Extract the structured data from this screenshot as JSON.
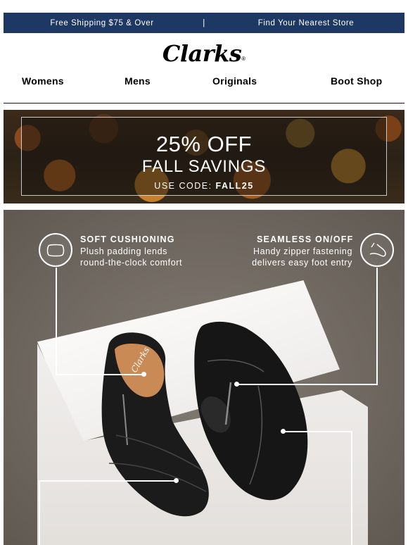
{
  "topbar": {
    "left_link": "Free Shipping $75 & Over",
    "separator": "|",
    "right_link": "Find Your Nearest Store",
    "bg_color": "#1e3864"
  },
  "brand": {
    "logo_text": "Clarks",
    "registered": "®"
  },
  "nav": {
    "items": [
      {
        "label": "Womens"
      },
      {
        "label": "Mens"
      },
      {
        "label": "Originals"
      },
      {
        "label": "Boot Shop"
      }
    ]
  },
  "promo": {
    "headline": "25% OFF",
    "subheadline": "FALL SAVINGS",
    "code_prefix": "USE CODE:",
    "code": "FALL25"
  },
  "hero": {
    "callouts": [
      {
        "title": "SOFT CUSHIONING",
        "line1": "Plush padding lends",
        "line2": "round-the-clock comfort",
        "icon": "pillow-icon"
      },
      {
        "title": "SEAMLESS ON/OFF",
        "line1": "Handy zipper fastening",
        "line2": "delivers easy foot entry",
        "icon": "foot-icon"
      }
    ],
    "insole_brand": "Clarks"
  }
}
